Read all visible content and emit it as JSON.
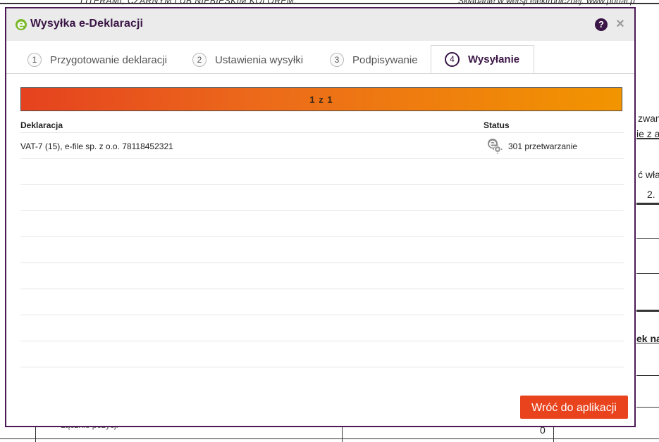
{
  "background": {
    "top_text": "LITERAMI, CZARNYM LUB NIEBIESKIM KOLOREM.",
    "top_text_right": "Składanie w wersji elektronicznej: www.portal.p",
    "frag1": "zwan",
    "frag2": "ie z a",
    "frag3": "ć wła",
    "frag4": "2.",
    "frag5": "ek na",
    "frag6": "0",
    "frag7": "Łącznie pozycji"
  },
  "modal": {
    "title": "Wysyłka e-Deklaracji",
    "help_label": "?",
    "close_label": "×"
  },
  "tabs": [
    {
      "num": "1",
      "label": "Przygotowanie deklaracji"
    },
    {
      "num": "2",
      "label": "Ustawienia wysyłki"
    },
    {
      "num": "3",
      "label": "Podpisywanie"
    },
    {
      "num": "4",
      "label": "Wysyłanie"
    }
  ],
  "progress": {
    "label": "1 z 1",
    "fraction": 1.0
  },
  "table": {
    "headers": {
      "declaration": "Deklaracja",
      "status": "Status"
    },
    "rows": [
      {
        "declaration": "VAT-7 (15), e-file sp. z o.o. 78118452321",
        "status": "301 przetwarzanie",
        "icon": "processing-gear-icon"
      }
    ]
  },
  "footer": {
    "back_label": "Wróć do aplikacji"
  },
  "colors": {
    "brand": "#3a1545",
    "accent": "#e8431c",
    "progress_start": "#e5421f",
    "progress_end": "#f29500",
    "logo_green": "#7ab829"
  }
}
